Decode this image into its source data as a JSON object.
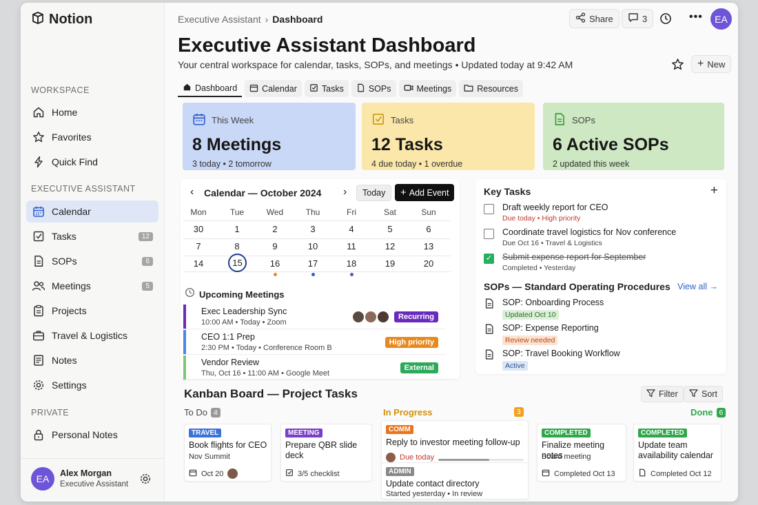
{
  "app": {
    "brand": "Notion"
  },
  "sidebar": {
    "workspace_title": "WORKSPACE",
    "workspace_items": [
      {
        "label": "Home",
        "icon": "home-icon"
      },
      {
        "label": "Favorites",
        "icon": "star-icon"
      },
      {
        "label": "Quick Find",
        "icon": "lightning-icon"
      }
    ],
    "ea_title": "EXECUTIVE ASSISTANT",
    "ea_items": [
      {
        "label": "Calendar",
        "icon": "calendar-icon",
        "active": true
      },
      {
        "label": "Tasks",
        "icon": "checkbox-icon",
        "count": "12"
      },
      {
        "label": "SOPs",
        "icon": "document-icon",
        "count": "6"
      },
      {
        "label": "Meetings",
        "icon": "people-icon",
        "count": "5"
      },
      {
        "label": "Projects",
        "icon": "clipboard-icon"
      },
      {
        "label": "Travel & Logistics",
        "icon": "suitcase-icon"
      },
      {
        "label": "Notes",
        "icon": "notes-icon"
      },
      {
        "label": "Settings",
        "icon": "gear-icon"
      }
    ],
    "private_title": "PRIVATE",
    "private_items": [
      {
        "label": "Personal Notes",
        "icon": "lock-icon"
      }
    ],
    "user": {
      "initials": "EA",
      "name": "Alex Morgan",
      "role": "Executive Assistant"
    }
  },
  "header": {
    "breadcrumb_parent": "Executive Assistant",
    "breadcrumb_current": "Dashboard",
    "share_label": "Share",
    "comments_count": "3",
    "avatar_initials": "EA",
    "title": "Executive Assistant Dashboard",
    "subtitle": "Your central workspace for calendar, tasks, SOPs, and meetings • Updated today at 9:42 AM",
    "new_label": "New"
  },
  "tabs": [
    "Dashboard",
    "Calendar",
    "Tasks",
    "SOPs",
    "Meetings",
    "Resources"
  ],
  "stats": [
    {
      "caption": "This Week",
      "big": "8 Meetings",
      "small": "3 today • 2 tomorrow",
      "color": "#c9d8f6"
    },
    {
      "caption": "Tasks",
      "big": "12 Tasks",
      "small": "4 due today • 1 overdue",
      "color": "#fbe7a9"
    },
    {
      "caption": "SOPs",
      "big": "6 Active SOPs",
      "small": "2 updated this week",
      "color": "#cde8c2"
    }
  ],
  "calendar": {
    "title": "Calendar — October 2024",
    "today_label": "Today",
    "add_label": "Add Event",
    "weekdays": [
      "Mon",
      "Tue",
      "Wed",
      "Thu",
      "Fri",
      "Sat",
      "Sun"
    ],
    "weeks": [
      [
        "30",
        "1",
        "2",
        "3",
        "4",
        "5",
        "6"
      ],
      [
        "7",
        "8",
        "9",
        "10",
        "11",
        "12",
        "13"
      ],
      [
        "14",
        "15",
        "16",
        "17",
        "18",
        "19",
        "20"
      ]
    ],
    "today": "15"
  },
  "upcoming": {
    "title": "Upcoming Meetings",
    "items": [
      {
        "name": "Exec Leadership Sync",
        "meta": "10:00 AM • Today • Zoom",
        "badge": "Recurring",
        "bar": "#6a2bbd",
        "badge_color": "#6a2bbd"
      },
      {
        "name": "CEO 1:1 Prep",
        "meta": "2:30 PM • Today • Conference Room B",
        "badge": "High priority",
        "bar": "#4a86e8",
        "badge_color": "#e8891f"
      },
      {
        "name": "Vendor Review",
        "meta": "Thu, Oct 16 • 11:00 AM • Google Meet",
        "badge": "External",
        "bar": "#7ac77a",
        "badge_color": "#2ea85a"
      }
    ]
  },
  "key_tasks": {
    "title": "Key Tasks",
    "items": [
      {
        "title": "Draft weekly report for CEO",
        "sub": "Due today • High priority",
        "done": false,
        "sub_color": "#c0392b"
      },
      {
        "title": "Coordinate travel logistics for Nov conference",
        "sub": "Due Oct 16 • Travel & Logistics",
        "done": false,
        "sub_color": "#444444"
      },
      {
        "title": "Submit expense report for September",
        "sub": "Completed • Yesterday",
        "done": true,
        "sub_color": "#444444"
      }
    ]
  },
  "sops": {
    "title": "SOPs — Standard Operating Procedures",
    "view_all": "View all →",
    "items": [
      {
        "title": "SOP: Onboarding Process",
        "badge": "Updated Oct 10",
        "bg": "#dcefd8",
        "fg": "#2b6b2b"
      },
      {
        "title": "SOP: Expense Reporting",
        "badge": "Review needed",
        "bg": "#fde2d2",
        "fg": "#b04b16"
      },
      {
        "title": "SOP: Travel Booking Workflow",
        "badge": "Active",
        "bg": "#dbe6f6",
        "fg": "#2d4f8a"
      }
    ]
  },
  "kanban": {
    "title": "Kanban Board — Project Tasks",
    "filter_label": "Filter",
    "sort_label": "Sort",
    "columns": [
      {
        "name": "To Do",
        "count": "4"
      },
      {
        "name": "In Progress",
        "count": "3"
      },
      {
        "name": "Done",
        "count": "6"
      }
    ],
    "cards": {
      "travel": {
        "tag": "TRAVEL",
        "title": "Book flights for CEO",
        "sub": "Nov Summit",
        "foot": "Oct 20"
      },
      "meeting": {
        "tag": "MEETING",
        "title": "Prepare QBR slide deck",
        "foot": "3/5 checklist"
      },
      "comm": {
        "tag": "COMM",
        "title": "Reply to investor meeting follow-up",
        "foot": "Due today",
        "progress": 0.6
      },
      "admin": {
        "tag": "ADMIN",
        "title": "Update contact directory",
        "sub": "Started yesterday • In review"
      },
      "done1": {
        "tag": "COMPLETED",
        "title": "Finalize meeting notes",
        "sub": "Board meeting",
        "foot": "Completed Oct 13"
      },
      "done2": {
        "tag": "COMPLETED",
        "title": "Update team availability calendar",
        "foot": "Completed Oct 12"
      }
    }
  }
}
